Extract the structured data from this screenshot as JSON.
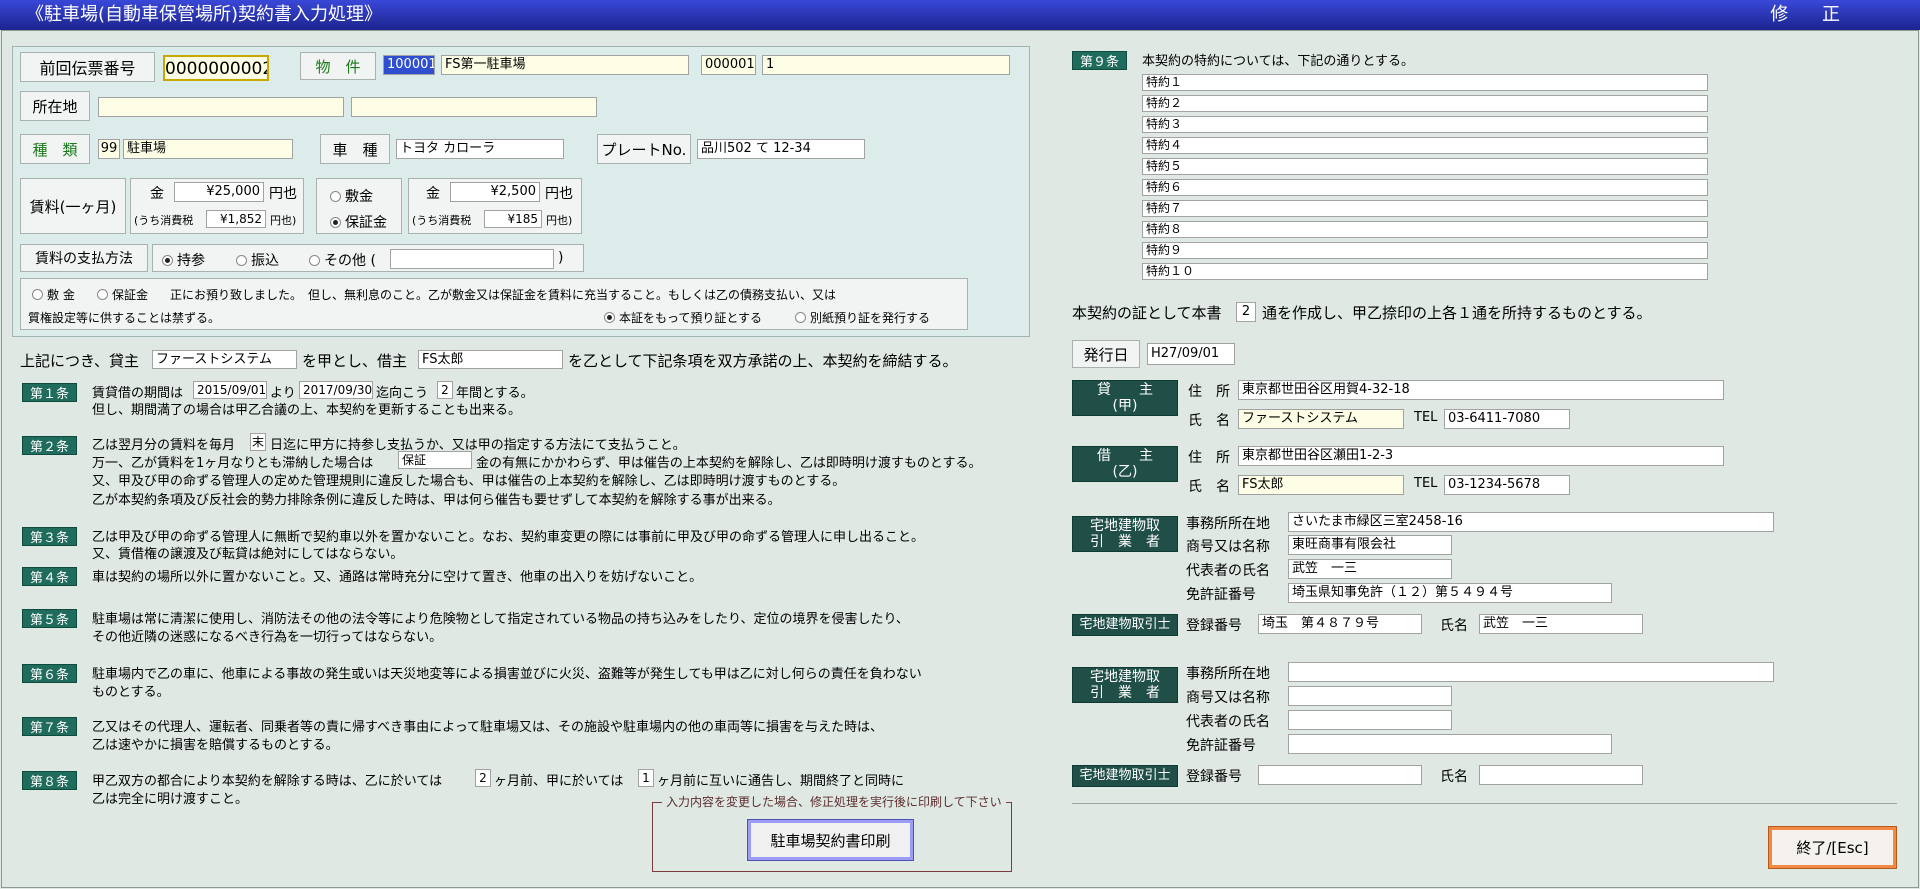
{
  "window": {
    "title": "《駐車場(自動車保管場所)契約書入力処理》",
    "mode": "修 正"
  },
  "top": {
    "prev_slip_label": "前回伝票番号",
    "prev_slip_value": "0000000002",
    "property_label": "物　件",
    "property_code": "100001",
    "property_name": "FS第一駐車場",
    "property_sub_code": "000001",
    "property_sub_name": "1",
    "location_label": "所在地",
    "location_value1": "",
    "location_value2": "",
    "type_label": "種　類",
    "type_code": "99",
    "type_name": "駐車場",
    "car_label": "車　種",
    "car_value": "トヨタ カローラ",
    "plate_label": "プレートNo.",
    "plate_value": "品川502 て 12-34",
    "rent_label": "賃料(一ヶ月)",
    "rent_kin": "金",
    "rent_amount": "¥25,000",
    "rent_unit": "円也",
    "rent_tax_label": "(うち消費税",
    "rent_tax": "¥1,852",
    "rent_tax_unit": "円也)",
    "deposit_opt1": "敷金",
    "deposit_opt2": "保証金",
    "deposit_kin": "金",
    "deposit_amount": "¥2,500",
    "deposit_unit": "円也",
    "deposit_tax_label": "(うち消費税",
    "deposit_tax": "¥185",
    "deposit_tax_unit": "円也)",
    "pay_label": "賃料の支払方法",
    "pay_opt1": "持参",
    "pay_opt2": "振込",
    "pay_opt3": "その他 (",
    "pay_other_value": "",
    "pay_close": ")",
    "note_opt1": "敷 金",
    "note_opt2": "保証金",
    "note_text1": "正にお預り致しました。　但し、無利息のこと。乙が敷金又は保証金を賃料に充当すること。もしくは乙の債務支払い、又は",
    "note_text2": "質権設定等に供することは禁ずる。",
    "note_opt3": "本証をもって預り証とする",
    "note_opt4": "別紙預り証を発行する"
  },
  "intro": {
    "pre": "上記につき、貸主",
    "lessor": "ファーストシステム",
    "mid": "を甲とし、借主",
    "lessee": "FS太郎",
    "post": "を乙として下記条項を双方承諾の上、本契約を締結する。"
  },
  "articles": {
    "a1": {
      "label": "第１条",
      "t1": "賃貸借の期間は",
      "from": "2015/09/01",
      "t2": "より",
      "to": "2017/09/30",
      "t3": "迄向こう",
      "years": "2",
      "t4": "年間とする。",
      "line2": "但し、期間満了の場合は甲乙合議の上、本契約を更新することも出来る。"
    },
    "a2": {
      "label": "第２条",
      "t1": "乙は翌月分の賃料を毎月",
      "day": "末",
      "t2": "日迄に甲方に持参し支払うか、又は甲の指定する方法にて支払うこと。",
      "t3": "万一、乙が賃料を1ヶ月なりとも滞納した場合は",
      "dep": "保証",
      "t4": "金の有無にかかわらず、甲は催告の上本契約を解除し、乙は即時明け渡すものとする。",
      "line3": "又、甲及び甲の命ずる管理人の定めた管理規則に違反した場合も、甲は催告の上本契約を解除し、乙は即時明け渡すものとする。",
      "line4": "乙が本契約条項及び反社会的勢力排除条例に違反した時は、甲は何ら催告も要せずして本契約を解除する事が出来る。"
    },
    "a3": {
      "label": "第３条",
      "line1": "乙は甲及び甲の命ずる管理人に無断で契約車以外を置かないこと。なお、契約車変更の際には事前に甲及び甲の命ずる管理人に申し出ること。",
      "line2": "又、賃借権の譲渡及び転貸は絶対にしてはならない。"
    },
    "a4": {
      "label": "第４条",
      "line1": "車は契約の場所以外に置かないこと。又、通路は常時充分に空けて置き、他車の出入りを妨げないこと。"
    },
    "a5": {
      "label": "第５条",
      "line1": "駐車場は常に清潔に使用し、消防法その他の法令等により危険物として指定されている物品の持ち込みをしたり、定位の境界を侵害したり、",
      "line2": "その他近隣の迷惑になるべき行為を一切行ってはならない。"
    },
    "a6": {
      "label": "第６条",
      "line1": "駐車場内で乙の車に、他車による事故の発生或いは天災地変等による損害並びに火災、盗難等が発生しても甲は乙に対し何らの責任を負わない",
      "line2": "ものとする。"
    },
    "a7": {
      "label": "第７条",
      "line1": "乙又はその代理人、運転者、同乗者等の責に帰すべき事由によって駐車場又は、その施設や駐車場内の他の車両等に損害を与えた時は、",
      "line2": "乙は速やかに損害を賠償するものとする。"
    },
    "a8": {
      "label": "第８条",
      "t1": "甲乙双方の都合により本契約を解除する時は、乙に於いては",
      "m1": "2",
      "t2": "ヶ月前、甲に於いては",
      "m2": "1",
      "t3": "ヶ月前に互いに通告し、期間終了と同時に",
      "line2": "乙は完全に明け渡すこと。"
    },
    "a9": {
      "label": "第９条",
      "text": "本契約の特約については、下記の通りとする。",
      "items": [
        "特約１",
        "特約２",
        "特約３",
        "特約４",
        "特約５",
        "特約６",
        "特約７",
        "特約８",
        "特約９",
        "特約１０"
      ]
    }
  },
  "proof": {
    "t1": "本契約の証として本書",
    "copies": "2",
    "t2": "通を作成し、甲乙捺印の上各１通を所持するものとする。"
  },
  "issue": {
    "label": "発行日",
    "value": "H27/09/01"
  },
  "lessor": {
    "label1": "貸　　主",
    "label2": "(甲)",
    "addr_label": "住　所",
    "addr": "東京都世田谷区用賀4-32-18",
    "name_label": "氏　名",
    "name": "ファーストシステム",
    "tel_label": "TEL",
    "tel": "03-6411-7080"
  },
  "lessee": {
    "label1": "借　　主",
    "label2": "(乙)",
    "addr_label": "住　所",
    "addr": "東京都世田谷区瀬田1-2-3",
    "name_label": "氏　名",
    "name": "FS太郎",
    "tel_label": "TEL",
    "tel": "03-1234-5678"
  },
  "broker1": {
    "label1": "宅地建物取",
    "label2": "引　業　者",
    "office_label": "事務所所在地",
    "office": "さいたま市緑区三室2458-16",
    "trade_label": "商号又は名称",
    "trade": "東旺商事有限会社",
    "rep_label": "代表者の氏名",
    "rep": "武笠　一三",
    "lic_label": "免許証番号",
    "lic": "埼玉県知事免許（１２）第５４９４号"
  },
  "agent1": {
    "label": "宅地建物取引士",
    "reg_label": "登録番号",
    "reg": "埼玉　第４８７９号",
    "name_label": "氏名",
    "name": "武笠　一三"
  },
  "broker2": {
    "label1": "宅地建物取",
    "label2": "引　業　者",
    "office_label": "事務所所在地",
    "office": "",
    "trade_label": "商号又は名称",
    "trade": "",
    "rep_label": "代表者の氏名",
    "rep": "",
    "lic_label": "免許証番号",
    "lic": ""
  },
  "agent2": {
    "label": "宅地建物取引士",
    "reg_label": "登録番号",
    "reg": "",
    "name_label": "氏名",
    "name": ""
  },
  "print": {
    "note": "入力内容を変更した場合、修正処理を実行後に印刷して下さい",
    "button": "駐車場契約書印刷"
  },
  "end_button": "終了/[Esc]"
}
